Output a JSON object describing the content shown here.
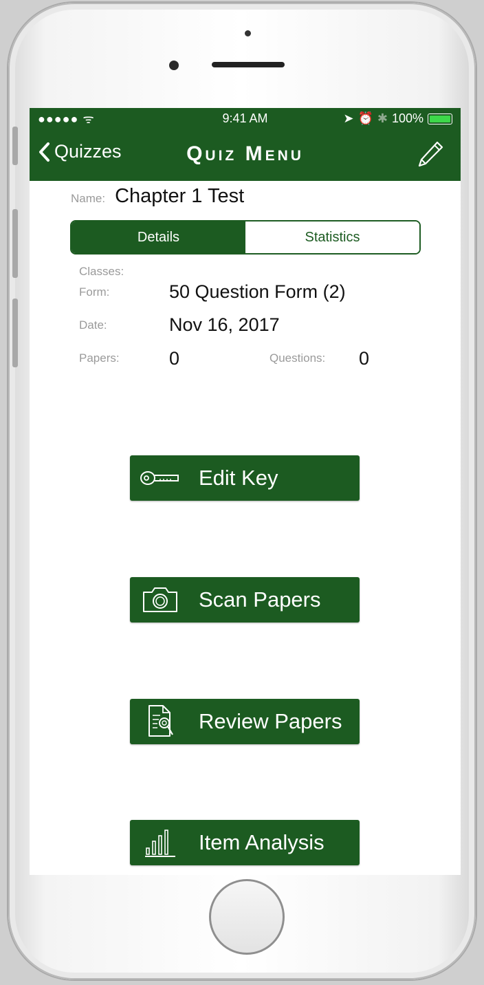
{
  "status_bar": {
    "signal": "●●●●● ᯤ",
    "time": "9:41 AM",
    "battery_percent": "100%",
    "battery_color": "#3dd84a"
  },
  "nav": {
    "back_label": "Quizzes",
    "title": "Quiz Menu",
    "edit_icon": "pencil-icon",
    "bar_color": "#1c5b21"
  },
  "quiz": {
    "name_label": "Name:",
    "name_value": "Chapter 1 Test"
  },
  "segmented": {
    "tabs": [
      {
        "label": "Details",
        "selected": true
      },
      {
        "label": "Statistics",
        "selected": false
      }
    ]
  },
  "details": {
    "classes_label": "Classes:",
    "form_label": "Form:",
    "form_value": "50 Question Form (2)",
    "date_label": "Date:",
    "date_value": "Nov 16, 2017",
    "papers_label": "Papers:",
    "papers_value": "0",
    "questions_label": "Questions:",
    "questions_value": "0"
  },
  "actions": [
    {
      "label": "Edit Key",
      "icon": "key-icon"
    },
    {
      "label": "Scan Papers",
      "icon": "camera-icon"
    },
    {
      "label": "Review Papers",
      "icon": "review-document-icon"
    },
    {
      "label": "Item Analysis",
      "icon": "bar-chart-icon"
    }
  ]
}
